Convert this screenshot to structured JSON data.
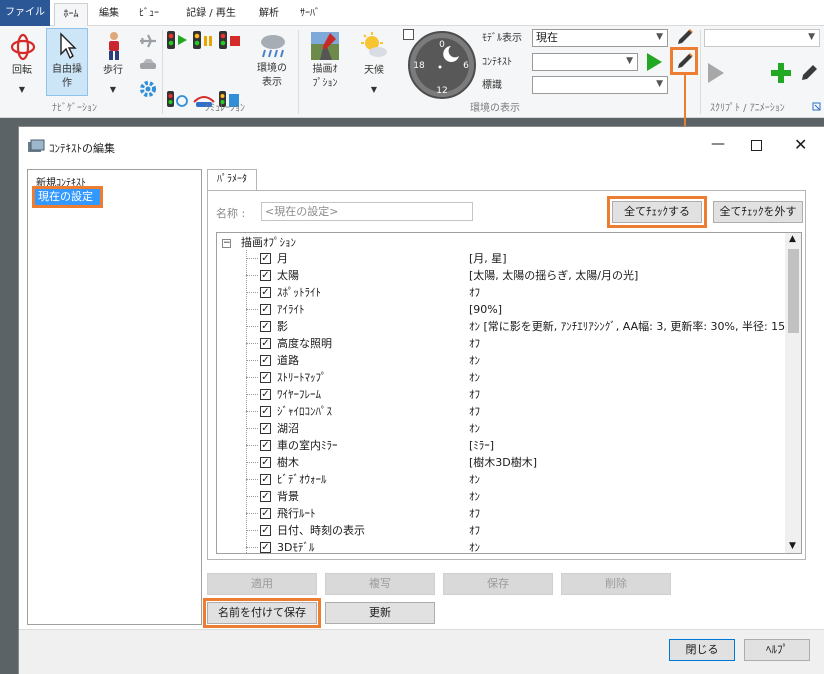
{
  "ribbon_tabs": [
    "ファイル",
    "ﾎｰﾑ",
    "編集",
    "ﾋﾞｭｰ",
    "記録 / 再生",
    "解析",
    "ｻｰﾊﾞ"
  ],
  "nav": {
    "rotate": "回転",
    "free": [
      "自由操",
      "作"
    ],
    "walk": "歩行",
    "group": "ﾅﾋﾞｹﾞｰｼｮﾝ"
  },
  "sim": {
    "weather_display": [
      "環境の",
      "表示"
    ],
    "draw_option": [
      "描画ｵ",
      "ﾌﾟｼｮﾝ"
    ],
    "weather": "天候",
    "group": "ｼﾐｭﾚｰｼｮﾝ"
  },
  "clock": {
    "n0": "0",
    "n6": "6",
    "n12": "12",
    "n18": "18"
  },
  "env": {
    "model_label": "ﾓﾃﾞﾙ表示",
    "model_value": "現在",
    "context_label": "ｺﾝﾃｷｽﾄ",
    "context_value": "",
    "sign_label": "標識",
    "sign_value": "",
    "group": "環境の表示"
  },
  "script_group": "ｽｸﾘﾌﾟﾄ / ｱﾆﾒｰｼｮﾝ",
  "dialog": {
    "title": "ｺﾝﾃｷｽﾄの編集",
    "contexts": [
      "新規ｺﾝﾃｷｽﾄ",
      "現在の設定"
    ],
    "tab": "ﾊﾟﾗﾒｰﾀ",
    "name_label": "名称 :",
    "name_value": "<現在の設定>",
    "check_all": "全てﾁｪｯｸする",
    "uncheck_all": "全てﾁｪｯｸを外す",
    "tree_root": "描画ｵﾌﾟｼｮﾝ",
    "options": [
      {
        "label": "月",
        "value": "[月, 星]"
      },
      {
        "label": "太陽",
        "value": "[太陽, 太陽の揺らぎ, 太陽/月の光]"
      },
      {
        "label": "ｽﾎﾟｯﾄﾗｲﾄ",
        "value": "ｵﾌ"
      },
      {
        "label": "ｱｲﾗｲﾄ",
        "value": "[90%]"
      },
      {
        "label": "影",
        "value": "ｵﾝ [常に影を更新, ｱﾝﾁｴﾘｱｼﾝｸﾞ, AA幅: 3, 更新率: 30%, 半径: 15..."
      },
      {
        "label": "高度な照明",
        "value": "ｵﾌ"
      },
      {
        "label": "道路",
        "value": "ｵﾝ"
      },
      {
        "label": "ｽﾄﾘｰﾄﾏｯﾌﾟ",
        "value": "ｵﾝ"
      },
      {
        "label": "ﾜｲﾔｰﾌﾚｰﾑ",
        "value": "ｵﾌ"
      },
      {
        "label": "ｼﾞｬｲﾛｺﾝﾊﾟｽ",
        "value": "ｵﾌ"
      },
      {
        "label": "湖沼",
        "value": "ｵﾝ"
      },
      {
        "label": "車の室内ﾐﾗｰ",
        "value": "[ﾐﾗｰ]"
      },
      {
        "label": "樹木",
        "value": "[樹木3D樹木]"
      },
      {
        "label": "ﾋﾞﾃﾞｵｳｫｰﾙ",
        "value": "ｵﾝ"
      },
      {
        "label": "背景",
        "value": "ｵﾝ"
      },
      {
        "label": "飛行ﾙｰﾄ",
        "value": "ｵﾌ"
      },
      {
        "label": "日付、時刻の表示",
        "value": "ｵﾌ"
      },
      {
        "label": "3Dﾓﾃﾞﾙ",
        "value": "ｵﾝ"
      }
    ],
    "apply": "適用",
    "copy": "複写",
    "save": "保存",
    "delete": "削除",
    "save_as": "名前を付けて保存",
    "update": "更新",
    "close": "閉じる",
    "help": "ﾍﾙﾌﾟ"
  },
  "colors": {
    "accent": "#ed7d31",
    "selection": "#3399ff",
    "file_tab": "#2b5797",
    "play": "#22a822"
  }
}
